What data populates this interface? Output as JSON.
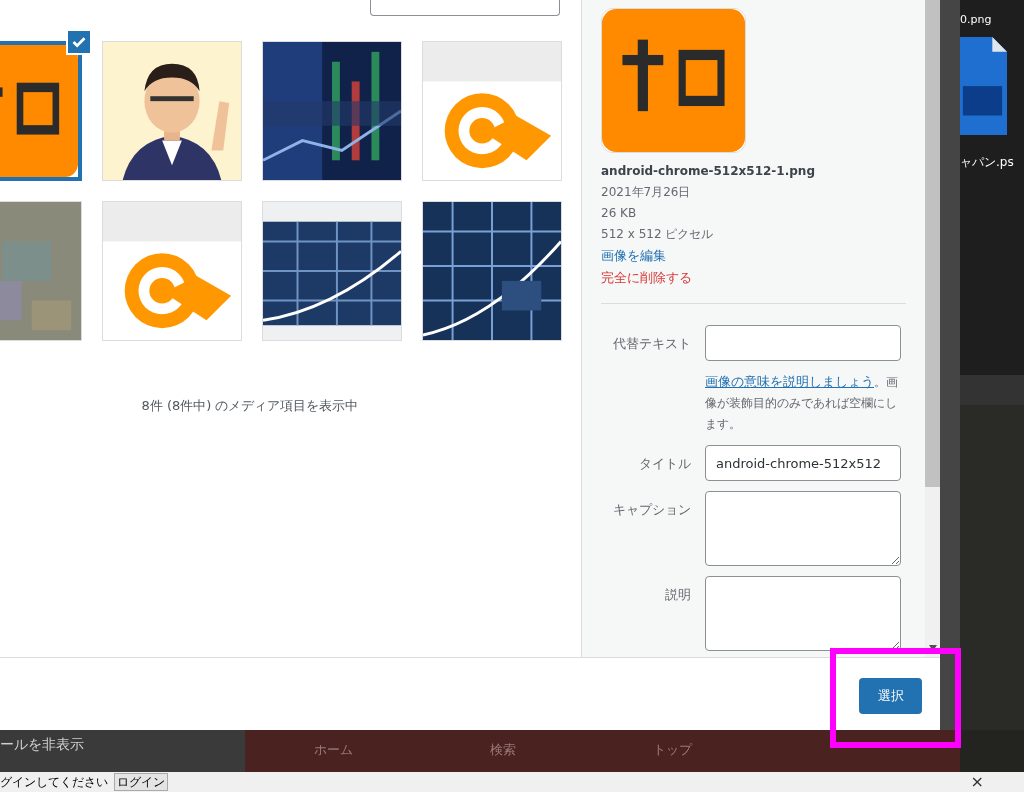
{
  "media_grid": {
    "items": [
      {
        "selected": true
      },
      {
        "selected": false
      },
      {
        "selected": false
      },
      {
        "selected": false
      },
      {
        "selected": false
      },
      {
        "selected": false
      },
      {
        "selected": false
      },
      {
        "selected": false
      }
    ]
  },
  "media_count": "8件 (8件中) のメディア項目を表示中",
  "attachment_details": {
    "filename": "android-chrome-512x512-1.png",
    "date": "2021年7月26日",
    "file_size": "26 KB",
    "dimensions": "512 x 512 ピクセル",
    "edit_link": "画像を編集",
    "delete_link": "完全に削除する"
  },
  "fields": [
    {
      "kind": "input",
      "label": "代替テキスト",
      "help_link": "画像の意味を説明しましょう",
      "help_text": "。画像が装飾目的のみであれば空欄にします。"
    },
    {
      "kind": "input",
      "label": "タイトル",
      "value": "android-chrome-512x512"
    },
    {
      "kind": "textarea",
      "label": "キャプション"
    },
    {
      "kind": "textarea",
      "label": "説明"
    }
  ],
  "select_button": "選択",
  "desktop_icons": [
    {
      "label": "0.png"
    },
    {
      "label": "ャパン.ps"
    }
  ],
  "background_page": {
    "toolbar_text": "ールを非表示",
    "nav": [
      "ホーム",
      "検索",
      "トップ"
    ]
  },
  "login_bar": {
    "message": "グインしてください",
    "button": "ログイン",
    "close": "×"
  }
}
